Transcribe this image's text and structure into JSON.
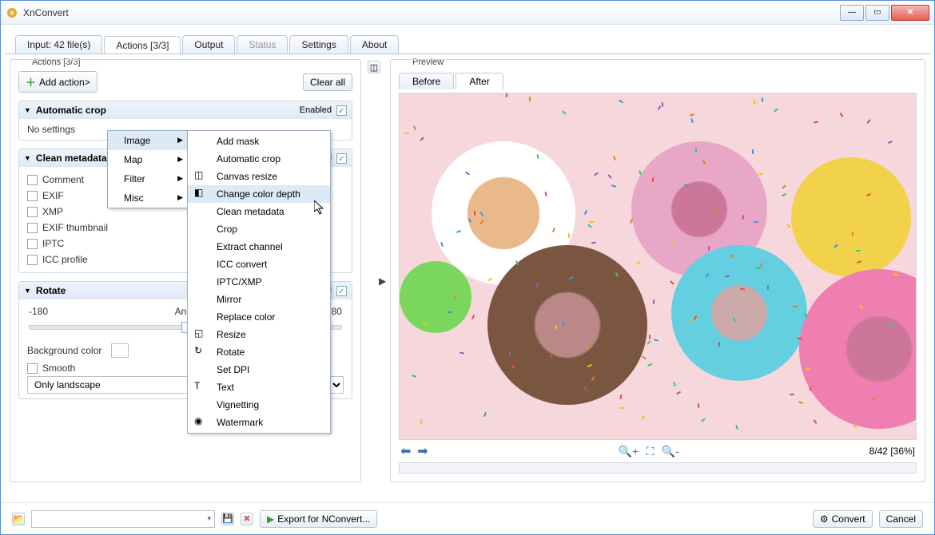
{
  "window": {
    "title": "XnConvert"
  },
  "tabs": {
    "input": "Input: 42 file(s)",
    "actions": "Actions [3/3]",
    "output": "Output",
    "status": "Status",
    "settings": "Settings",
    "about": "About"
  },
  "actions_panel": {
    "label": "Actions [3/3]",
    "add_action": "Add action>",
    "clear_all": "Clear all",
    "groups": {
      "auto": {
        "name": "Automatic crop",
        "enabled_label": "Enabled",
        "body": "No settings"
      },
      "clean": {
        "name": "Clean metadata",
        "enabled_label": "Enabled",
        "items": [
          "Comment",
          "EXIF",
          "XMP",
          "EXIF thumbnail",
          "IPTC",
          "ICC profile"
        ]
      },
      "rotate": {
        "name": "Rotate",
        "enabled_label": "Enabled",
        "min": "-180",
        "label_angle": "Angle",
        "max": "180",
        "bgcolor_label": "Background color",
        "smooth": "Smooth",
        "orient_select": "Only landscape"
      }
    }
  },
  "menu1": [
    "Image",
    "Map",
    "Filter",
    "Misc"
  ],
  "menu2": [
    {
      "label": "Add mask",
      "icon": ""
    },
    {
      "label": "Automatic crop",
      "icon": ""
    },
    {
      "label": "Canvas resize",
      "icon": "◫"
    },
    {
      "label": "Change color depth",
      "icon": "◧",
      "hl": true
    },
    {
      "label": "Clean metadata",
      "icon": ""
    },
    {
      "label": "Crop",
      "icon": ""
    },
    {
      "label": "Extract channel",
      "icon": ""
    },
    {
      "label": "ICC convert",
      "icon": ""
    },
    {
      "label": "IPTC/XMP",
      "icon": ""
    },
    {
      "label": "Mirror",
      "icon": ""
    },
    {
      "label": "Replace color",
      "icon": ""
    },
    {
      "label": "Resize",
      "icon": "◱"
    },
    {
      "label": "Rotate",
      "icon": "↻"
    },
    {
      "label": "Set DPI",
      "icon": ""
    },
    {
      "label": "Text",
      "icon": "T"
    },
    {
      "label": "Vignetting",
      "icon": ""
    },
    {
      "label": "Watermark",
      "icon": "◉"
    }
  ],
  "preview": {
    "label": "Preview",
    "before": "Before",
    "after": "After",
    "status": "8/42 [36%]"
  },
  "bottom": {
    "export": "Export for NConvert...",
    "convert": "Convert",
    "cancel": "Cancel"
  }
}
